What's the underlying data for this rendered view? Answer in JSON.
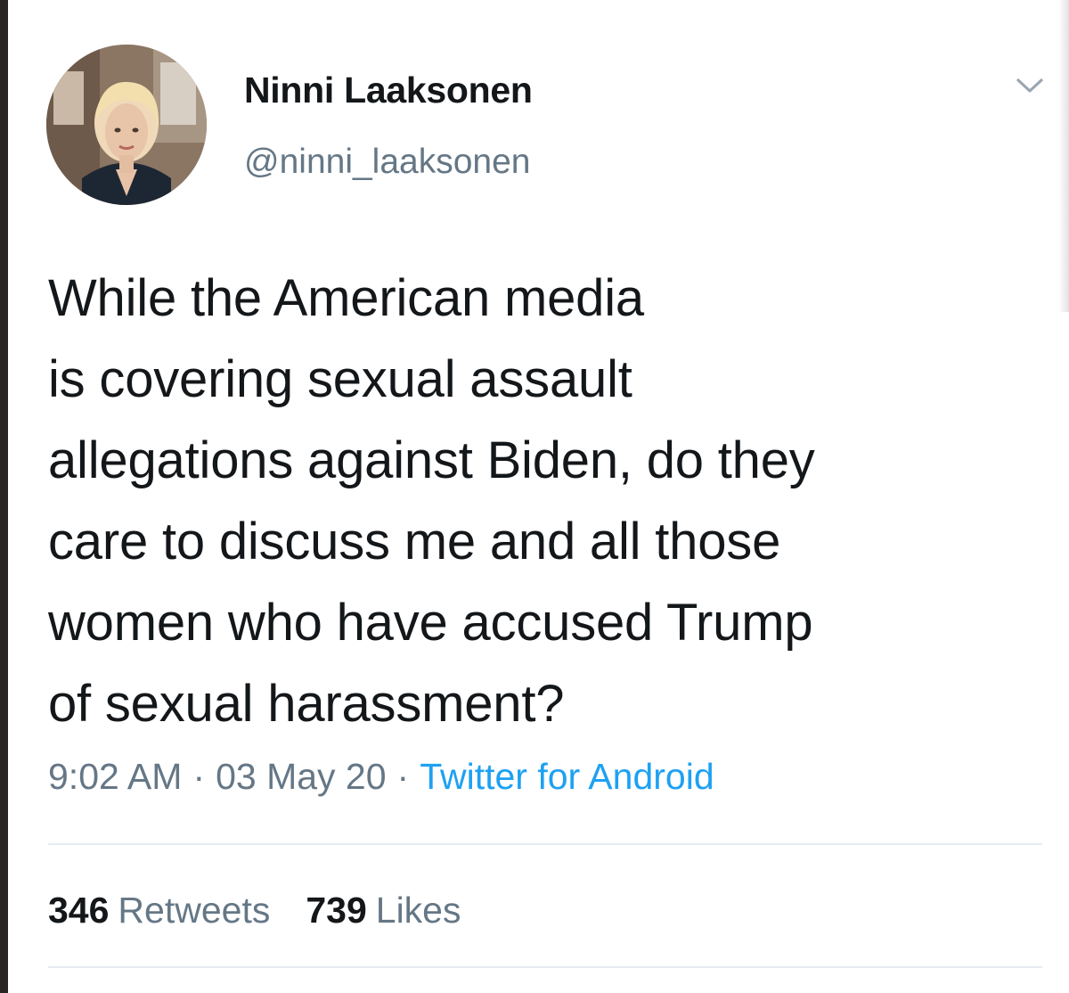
{
  "author": {
    "display_name": "Ninni Laaksonen",
    "handle": "@ninni_laaksonen"
  },
  "icons": {
    "more": "chevron-down-icon"
  },
  "tweet": {
    "text_lines": [
      "While the American media",
      "is covering sexual assault",
      "allegations against Biden, do they",
      "care to discuss me and all those",
      "women who have accused Trump",
      "of sexual harassment?"
    ],
    "time": "9:02 AM",
    "date": "03 May 20",
    "separator": "·",
    "source": "Twitter for Android"
  },
  "stats": {
    "retweets_count": "346",
    "retweets_label": "Retweets",
    "likes_count": "739",
    "likes_label": "Likes"
  },
  "colors": {
    "text_primary": "#14171a",
    "text_secondary": "#657786",
    "link": "#1da1f2",
    "divider": "#e6ecf0"
  }
}
